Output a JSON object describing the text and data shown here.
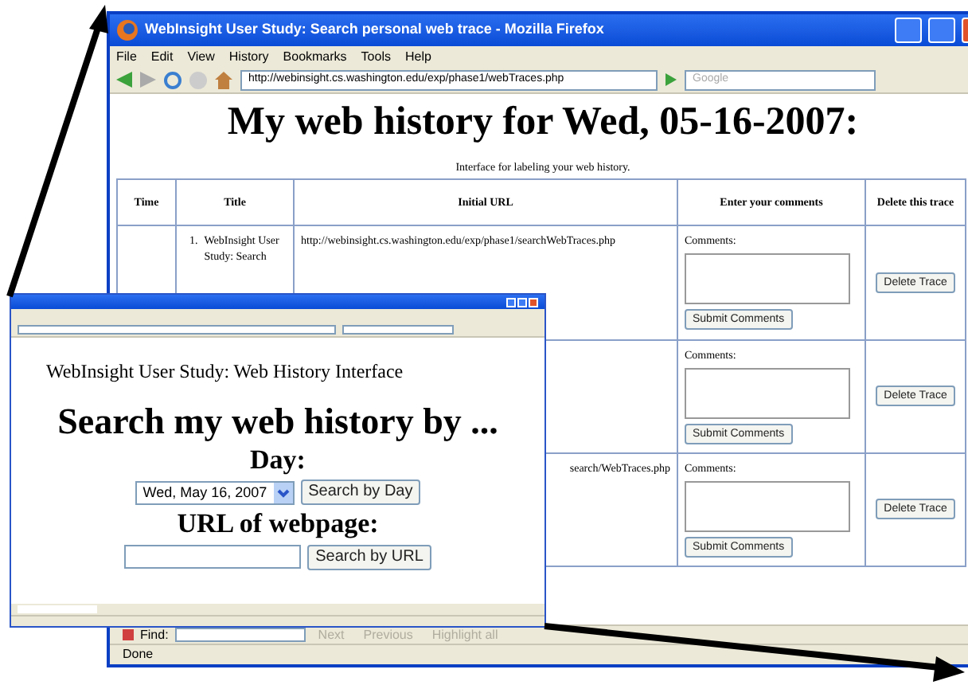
{
  "browser": {
    "title": "WebInsight User Study: Search personal web trace - Mozilla Firefox",
    "menu": [
      "File",
      "Edit",
      "View",
      "History",
      "Bookmarks",
      "Tools",
      "Help"
    ],
    "url": "http://webinsight.cs.washington.edu/exp/phase1/webTraces.php",
    "search_placeholder": "Google",
    "find_label": "Find:",
    "find_options": [
      "Next",
      "Previous",
      "Highlight all"
    ],
    "status": "Done"
  },
  "page": {
    "heading": "My web history for Wed, 05-16-2007:",
    "caption": "Interface for labeling your web history.",
    "columns": [
      "Time",
      "Title",
      "Initial URL",
      "Enter your comments",
      "Delete this trace"
    ],
    "rows": [
      {
        "number": "1.",
        "title": "WebInsight User Study: Search",
        "url": "http://webinsight.cs.washington.edu/exp/phase1/searchWebTraces.php",
        "comments_label": "Comments:",
        "submit": "Submit Comments",
        "delete": "Delete Trace"
      },
      {
        "comments_label": "Comments:",
        "submit": "Submit Comments",
        "delete": "Delete Trace"
      },
      {
        "url": "search/WebTraces.php",
        "comments_label": "Comments:",
        "submit": "Submit Comments",
        "delete": "Delete Trace"
      }
    ]
  },
  "popup": {
    "intro": "WebInsight User Study: Web History Interface",
    "heading": "Search my web history by ...",
    "day_label": "Day:",
    "day_value": "Wed, May 16, 2007",
    "day_button": "Search by Day",
    "url_label": "URL of webpage:",
    "url_button": "Search by URL"
  }
}
